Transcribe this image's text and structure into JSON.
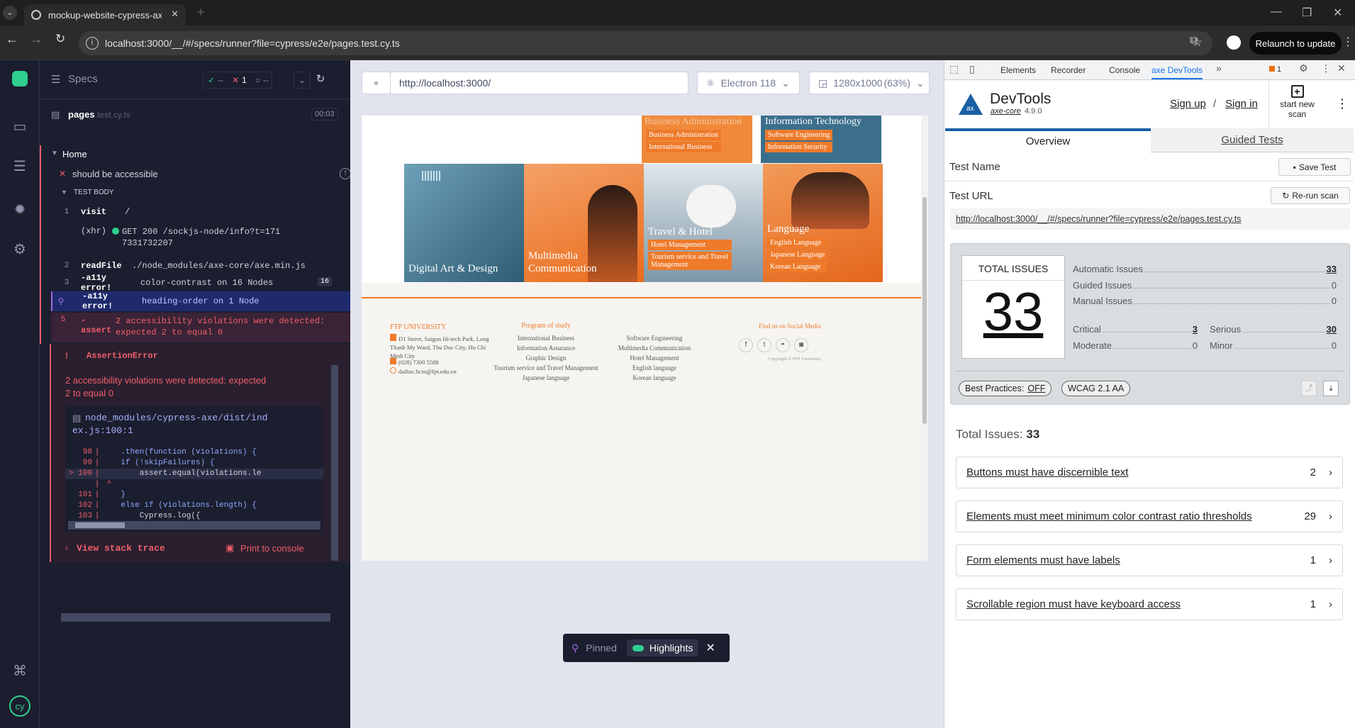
{
  "browser": {
    "tab_title": "mockup-website-cypress-axe-ir",
    "url": "localhost:3000/__/#/specs/runner?file=cypress/e2e/pages.test.cy.ts",
    "relaunch_label": "Relaunch to update"
  },
  "cypress": {
    "specs_label": "Specs",
    "passed": "--",
    "failed": "1",
    "pending": "--",
    "spec_file": "pages",
    "spec_ext": ".test.cy.ts",
    "duration": "00:03",
    "suite": "Home",
    "test_title": "should be accessible",
    "test_body": "TEST BODY",
    "commands": [
      {
        "num": "1",
        "name": "visit",
        "msg": "/"
      },
      {
        "num": "",
        "name": "(xhr)",
        "msg": "GET 200 /sockjs-node/info?t=1717331732207"
      },
      {
        "num": "2",
        "name": "readFile",
        "msg": "./node_modules/axe-core/axe.min.js"
      },
      {
        "num": "3",
        "name": "-a11y error!",
        "msg": "color-contrast on 16 Nodes",
        "badge": "16"
      },
      {
        "num": "",
        "name": "-a11y error!",
        "msg": "heading-order on 1 Node"
      },
      {
        "num": "5",
        "name": "-assert",
        "msg": "2 accessibility violations were detected: expected 2 to equal 0"
      }
    ],
    "error_name": "AssertionError",
    "error_message": "2 accessibility violations were detected: expected 2 to equal 0",
    "error_file": "node_modules/cypress-axe/dist/index.js:100:1",
    "code_lines": [
      {
        "n": "98",
        "code": "    .then(function (violations) {"
      },
      {
        "n": "99",
        "code": "    if (!skipFailures) {"
      },
      {
        "n": "> 100",
        "code": "        assert.equal(violations.le"
      },
      {
        "n": "",
        "code": " ^"
      },
      {
        "n": "101",
        "code": "    }"
      },
      {
        "n": "102",
        "code": "    else if (violations.length) {"
      },
      {
        "n": "103",
        "code": "        Cypress.log({"
      }
    ],
    "view_stack": "View stack trace",
    "print_console": "Print to console"
  },
  "runner": {
    "aut_url": "http://localhost:3000/",
    "browser_label": "Electron 118",
    "viewport_label": "1280x1000",
    "viewport_scale": "(63%)",
    "pinned_label": "Pinned",
    "highlights_label": "Highlights"
  },
  "website": {
    "top_tiles": [
      {
        "title": "Business Administration",
        "subs": [
          "Business Administration",
          "International Business"
        ]
      },
      {
        "title": "Information Technology",
        "subs": [
          "Software Engineering",
          "Information Security"
        ]
      }
    ],
    "tiles": [
      {
        "title": "Digital Art & Design",
        "subs": [],
        "color": "#3b6f8c"
      },
      {
        "title": "Multimedia Communication",
        "subs": [],
        "color": "#f08a3a"
      },
      {
        "title": "Travel & Hotel",
        "subs": [
          "Hotel Management",
          "Tourism service and Travel Management"
        ],
        "color": "#6b8fa6"
      },
      {
        "title": "Language",
        "subs": [
          "English Language",
          "Japanese Language",
          "Korean Language"
        ],
        "color": "#f08a3a"
      }
    ],
    "footer": {
      "uni_name": "FTP UNIVERSITY",
      "address": "D1 Street, Saigon Hi-tech Park, Long Thanh My Ward, Thu Duc City, Ho Chi Minh City",
      "phone": "(028) 7300 5588",
      "email": "daihoc.hcm@fpt.edu.vn",
      "program_heading": "Program of study",
      "programs_col1": [
        "International Business",
        "Information Assurance",
        "Graphic Design",
        "Tourism service and Travel Management",
        "Japanese language"
      ],
      "programs_col2": [
        "Software Engineering",
        "Multimedia Communication",
        "Hotel Management",
        "English language",
        "Korean language"
      ],
      "social_heading": "Find us on Social Media",
      "copyright": "Copyright © FPT University"
    }
  },
  "devtools": {
    "tabs": [
      "Elements",
      "Recorder",
      "Console",
      "axe DevTools"
    ],
    "issue_count_badge": "1",
    "brand": "DevTools",
    "core": "axe-core",
    "version": "4.9.0",
    "sign_up": "Sign up",
    "sign_in": "Sign in",
    "start_scan": "start new scan",
    "tab_overview": "Overview",
    "tab_guided": "Guided Tests",
    "test_name_label": "Test Name",
    "save_test": "Save Test",
    "test_url_label": "Test URL",
    "rerun": "Re-run scan",
    "test_url": "http://localhost:3000/__/#/specs/runner?file=cypress/e2e/pages.test.cy.ts",
    "total_issues_label": "TOTAL ISSUES",
    "total_issues": "33",
    "stats": [
      {
        "label": "Automatic Issues",
        "value": "33"
      },
      {
        "label": "Guided Issues",
        "value": "0"
      },
      {
        "label": "Manual Issues",
        "value": "0"
      }
    ],
    "severity": [
      {
        "label": "Critical",
        "value": "3"
      },
      {
        "label": "Serious",
        "value": "30"
      },
      {
        "label": "Moderate",
        "value": "0"
      },
      {
        "label": "Minor",
        "value": "0"
      }
    ],
    "best_practices": "Best Practices:",
    "best_practices_state": "OFF",
    "wcag": "WCAG 2.1 AA",
    "total_issues_heading": "Total Issues:",
    "issues": [
      {
        "title": "Buttons must have discernible text",
        "count": "2"
      },
      {
        "title": "Elements must meet minimum color contrast ratio thresholds",
        "count": "29"
      },
      {
        "title": "Form elements must have labels",
        "count": "1"
      },
      {
        "title": "Scrollable region must have keyboard access",
        "count": "1"
      }
    ]
  }
}
